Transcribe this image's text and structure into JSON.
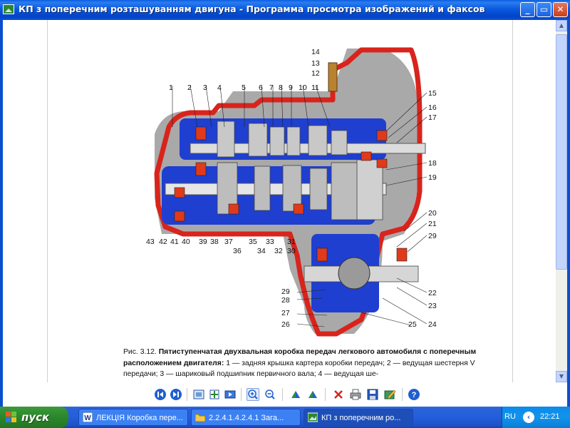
{
  "window": {
    "title": "КП з поперечним розташуванням двигуна - Программа просмотра изображений и факсов",
    "minimize_glyph": "_",
    "maximize_glyph": "▭",
    "close_glyph": "✕"
  },
  "figure": {
    "part_labels": [
      "1",
      "2",
      "3",
      "4",
      "5",
      "6",
      "7",
      "8",
      "9",
      "10",
      "11",
      "12",
      "13",
      "14",
      "15",
      "16",
      "17",
      "18",
      "19",
      "20",
      "21",
      "22",
      "23",
      "24",
      "25",
      "26",
      "27",
      "28",
      "29",
      "30",
      "31",
      "32",
      "33",
      "34",
      "35",
      "36",
      "37",
      "38",
      "39",
      "40",
      "41",
      "42",
      "43"
    ],
    "caption_prefix": "Рис. 3.12. ",
    "caption_bold": "Пятиступенчатая двухвальная коробка передач легкового автомобиля с поперечным расположением двигателя: ",
    "caption_rest": "1 — задняя крышка картера коробки передач; 2 — ведущая шестерня V передачи; 3 — шариковый подшипник первичного вала; 4 — ведущая ше-"
  },
  "toolbar": {
    "buttons": [
      "prev-image-icon",
      "next-image-icon",
      "best-fit-icon",
      "actual-size-icon",
      "slideshow-icon",
      "zoom-in-icon",
      "zoom-out-icon",
      "rotate-clockwise-icon",
      "rotate-counterclockwise-icon",
      "delete-icon",
      "print-icon",
      "save-icon",
      "edit-icon",
      "help-icon"
    ]
  },
  "taskbar": {
    "start_label": "пуск",
    "tasks": [
      {
        "label": "ЛЕКЦІЯ Коробка пере...",
        "icon": "word-icon"
      },
      {
        "label": "2.2.4.1.4.2.4.1 Зага...",
        "icon": "folder-icon"
      },
      {
        "label": "КП з поперечним ро...",
        "icon": "image-viewer-icon"
      }
    ],
    "language": "RU",
    "clock": "22:21"
  },
  "colors": {
    "titlebar": "#0a5adf",
    "housing_red": "#d8241c",
    "gear_blue": "#1f3fd0",
    "casing_gray": "#a9a9a9",
    "taskbar": "#245edb",
    "start_green": "#2d8a2d"
  }
}
